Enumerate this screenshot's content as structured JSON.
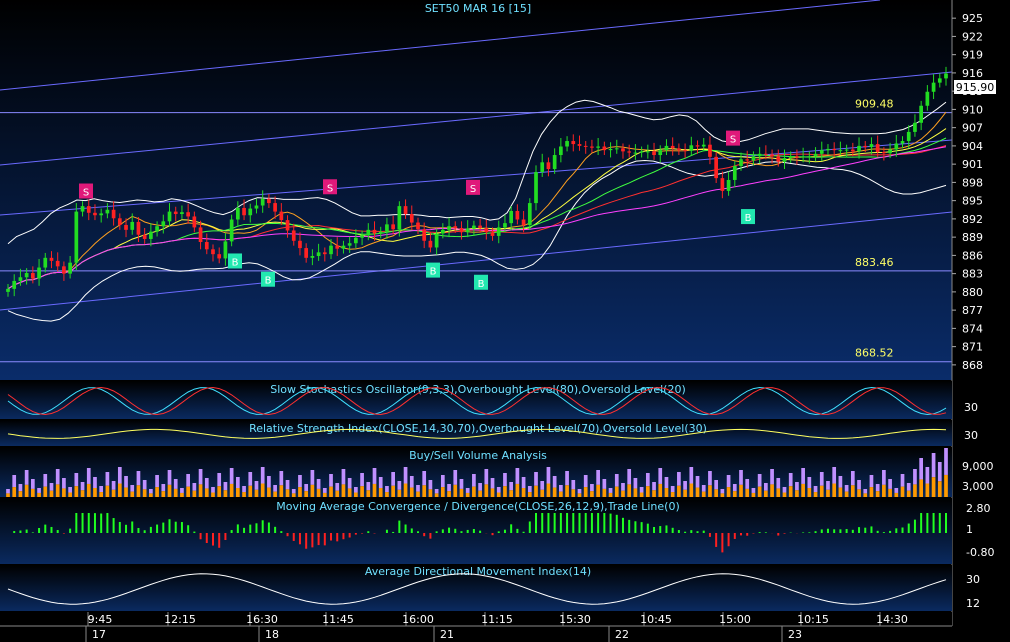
{
  "main": {
    "title": "SET50 MAR 16   [15]",
    "last_price": "915.90",
    "y_ticks": [
      "925",
      "922",
      "919",
      "916",
      "913",
      "910",
      "907",
      "904",
      "901",
      "898",
      "895",
      "892",
      "889",
      "886",
      "883",
      "880",
      "877",
      "874",
      "871",
      "868"
    ],
    "level_lines": [
      {
        "label": "909.48",
        "value": 909.48
      },
      {
        "label": "883.46",
        "value": 883.46
      },
      {
        "label": "868.52",
        "value": 868.52
      }
    ],
    "signals": [
      {
        "type": "S",
        "value": 896.5
      },
      {
        "type": "B",
        "value": 885
      },
      {
        "type": "B",
        "value": 882
      },
      {
        "type": "S",
        "value": 897.2
      },
      {
        "type": "B",
        "value": 883.5
      },
      {
        "type": "B",
        "value": 881.5
      },
      {
        "type": "S",
        "value": 897.1
      },
      {
        "type": "S",
        "value": 905.2
      },
      {
        "type": "B",
        "value": 892.3
      }
    ],
    "colors": {
      "bull": "#22dd22",
      "bear": "#ff2222",
      "signal_s": "#e0197a",
      "signal_b": "#22e8b0",
      "bg_top": "#000000",
      "bg_bottom": "#0a2c6a"
    }
  },
  "panels": {
    "stochastic": {
      "title": "Slow Stochastics Oscillator(9,3,3),Overbought Level(80),Oversold Level(20)",
      "tick": "30"
    },
    "rsi": {
      "title": "Relative Strength Index(CLOSE,14,30,70),Overbought Level(70),Oversold Level(30)",
      "tick": "30"
    },
    "volume": {
      "title": "Buy/Sell Volume Analysis",
      "ticks": [
        "9,000",
        "3,000"
      ]
    },
    "macd": {
      "title": "Moving Average Convergence / Divergence(CLOSE,26,12,9),Trade Line(0)",
      "ticks": [
        "2.80",
        "1",
        "-0.80"
      ]
    },
    "adx": {
      "title": "Average Directional Movement Index(14)",
      "ticks": [
        "30",
        "12"
      ]
    }
  },
  "x_axis": {
    "times": [
      "9:45",
      "12:15",
      "16:30",
      "11:45",
      "16:00",
      "11:15",
      "15:30",
      "10:45",
      "15:00",
      "10:15",
      "14:30"
    ],
    "dates": [
      "17",
      "18",
      "21",
      "22",
      "23"
    ]
  },
  "chart_data": {
    "type": "candlestick",
    "title": "SET50 MAR 16   [15]",
    "ylim": [
      866.5,
      927
    ],
    "closes": [
      880.5,
      881.8,
      882.4,
      883.1,
      882.2,
      884.0,
      885.6,
      885.1,
      884.2,
      883.0,
      884.8,
      893.2,
      894.1,
      893.0,
      892.6,
      892.9,
      893.5,
      892.1,
      891.0,
      890.2,
      891.5,
      889.4,
      888.7,
      889.9,
      890.8,
      891.6,
      893.2,
      892.8,
      893.1,
      892.4,
      890.6,
      888.2,
      887.0,
      886.2,
      885.5,
      888.3,
      891.9,
      893.8,
      892.6,
      893.7,
      894.2,
      895.3,
      894.6,
      893.2,
      891.8,
      890.1,
      888.4,
      887.2,
      885.6,
      885.9,
      886.5,
      886.2,
      887.6,
      887.1,
      887.6,
      888.0,
      888.9,
      889.3,
      890.2,
      889.6,
      889.9,
      891.1,
      890.3,
      894.1,
      892.8,
      891.4,
      890.3,
      888.4,
      887.3,
      889.6,
      890.2,
      890.8,
      890.5,
      889.8,
      890.4,
      890.9,
      890.5,
      889.8,
      889.2,
      890.6,
      891.3,
      893.3,
      891.9,
      891.0,
      894.6,
      899.7,
      901.3,
      900.2,
      902.5,
      903.9,
      904.8,
      904.3,
      904.0,
      903.9,
      903.7,
      903.9,
      903.3,
      903.5,
      903.6,
      903.1,
      902.9,
      902.9,
      903.1,
      903.1,
      902.5,
      903.3,
      904.0,
      903.6,
      903.3,
      903.2,
      904.1,
      903.9,
      904.2,
      902.2,
      898.7,
      896.6,
      898.4,
      900.7,
      901.8,
      901.6,
      902.3,
      902.7,
      902.6,
      902.3,
      901.4,
      902.0,
      902.3,
      902.1,
      902.3,
      902.3,
      902.7,
      903.3,
      903.5,
      903.3,
      903.3,
      903.4,
      903.1,
      904.0,
      903.8,
      904.3,
      903.0,
      902.8,
      903.4,
      904.4,
      904.8,
      906.3,
      907.8,
      910.6,
      912.9,
      914.4,
      915.1,
      915.9
    ],
    "upper_band": [
      887.9,
      889.1,
      889.7,
      890.3,
      891.5,
      892.9,
      893.8,
      894.4,
      895.1,
      895.0,
      895.3,
      895.0,
      894.8,
      894.7,
      894.9,
      895.1,
      895.0,
      894.8,
      894.9,
      895.3,
      895.1,
      894.7,
      894.1,
      893.5,
      893.0,
      892.7,
      893.2,
      894.2,
      895.0,
      895.5,
      895.4,
      895.4,
      895.2,
      895.2,
      895.2,
      895.4,
      895.5,
      895.2,
      894.6,
      893.8,
      893.0,
      892.5,
      892.5,
      892.6,
      892.6,
      892.7,
      892.7,
      892.7,
      892.6,
      892.4,
      892.4,
      892.2,
      892.3,
      892.4,
      892.4,
      892.2,
      891.8,
      892.0,
      893.0,
      895.4,
      899.3,
      903.1,
      905.9,
      907.9,
      909.5,
      910.5,
      911.2,
      911.5,
      911.3,
      910.8,
      910.3,
      909.7,
      909.4,
      909.0,
      908.6,
      908.3,
      908.4,
      908.8,
      909.1,
      908.9,
      908.1,
      906.7,
      905.5,
      904.8,
      904.6,
      904.7,
      905.0,
      905.5,
      906.0,
      906.4,
      906.8,
      906.8,
      906.8,
      906.8,
      906.6,
      906.4,
      906.2,
      906.1,
      906.0,
      906.0,
      906.0,
      906.0,
      906.1,
      906.4,
      906.7,
      907.3,
      908.1,
      909.1,
      910.1,
      911.2
    ],
    "lower_band": [
      876.9,
      876.3,
      875.9,
      875.5,
      875.3,
      875.2,
      875.5,
      876.5,
      877.9,
      879.5,
      880.8,
      881.8,
      882.6,
      883.3,
      883.8,
      884.1,
      884.2,
      884.1,
      883.8,
      883.5,
      883.4,
      883.5,
      883.7,
      883.8,
      883.8,
      883.9,
      884.2,
      884.6,
      884.8,
      884.6,
      884.0,
      883.3,
      882.5,
      882.0,
      882.0,
      882.3,
      883.0,
      883.8,
      884.6,
      885.5,
      886.2,
      886.6,
      886.6,
      886.4,
      886.2,
      886.0,
      885.9,
      885.9,
      885.9,
      886.0,
      886.1,
      886.3,
      886.5,
      886.5,
      886.3,
      886.0,
      885.4,
      884.6,
      883.9,
      883.7,
      883.9,
      884.5,
      885.7,
      887.6,
      890.1,
      892.6,
      894.6,
      896.3,
      897.6,
      898.6,
      899.4,
      900.3,
      901.0,
      901.5,
      901.6,
      901.5,
      901.1,
      900.6,
      900.0,
      899.5,
      899.2,
      899.0,
      899.2,
      899.5,
      899.9,
      900.3,
      900.7,
      901.0,
      901.3,
      901.4,
      901.3,
      901.1,
      900.9,
      900.7,
      900.5,
      900.4,
      900.2,
      900.1,
      899.8,
      899.3,
      898.6,
      897.8,
      897.0,
      896.4,
      896.1,
      896.1,
      896.3,
      896.7,
      897.1,
      897.5
    ]
  }
}
